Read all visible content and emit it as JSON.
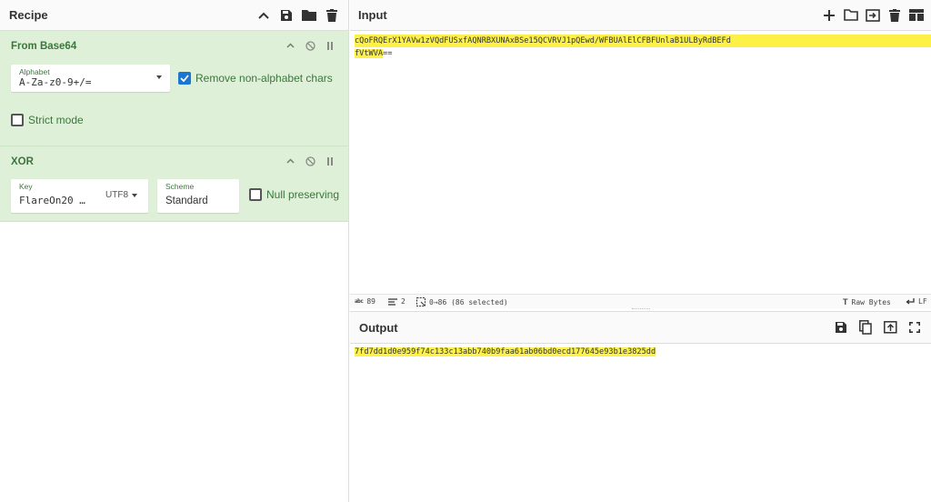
{
  "recipe": {
    "title": "Recipe",
    "operations": {
      "from_base64": {
        "title": "From Base64",
        "alphabet_label": "Alphabet",
        "alphabet_value": "A-Za-z0-9+/=",
        "remove_nonalpha_label": "Remove non-alphabet chars",
        "remove_nonalpha_checked": true,
        "strict_mode_label": "Strict mode",
        "strict_mode_checked": false
      },
      "xor": {
        "title": "XOR",
        "key_label": "Key",
        "key_value": "FlareOn20 …",
        "key_encoding": "UTF8",
        "scheme_label": "Scheme",
        "scheme_value": "Standard",
        "null_preserving_label": "Null preserving",
        "null_preserving_checked": false
      }
    }
  },
  "input": {
    "title": "Input",
    "line1": "cQoFRQErX1YAVw1zVQdFUSxfAQNRBXUNAxBSe15QCVRVJ1pQEwd/WFBUAlElCFBFUnlaB1ULByRdBEFd",
    "line2_highlight": "fVtWVA",
    "line2_rest": "==",
    "status": {
      "length": "89",
      "lines": "2",
      "selection": "0→86 (86 selected)",
      "encoding": "Raw Bytes",
      "eol": "LF"
    }
  },
  "output": {
    "title": "Output",
    "text": "7fd7dd1d0e959f74c133c13abb740b9faa61ab06bd0ecd177645e93b1e3825dd"
  },
  "colors": {
    "operation_bg": "#dff0d8",
    "operation_text": "#3c763d",
    "highlight": "#fdf148",
    "checkbox_on": "#1976d2"
  }
}
